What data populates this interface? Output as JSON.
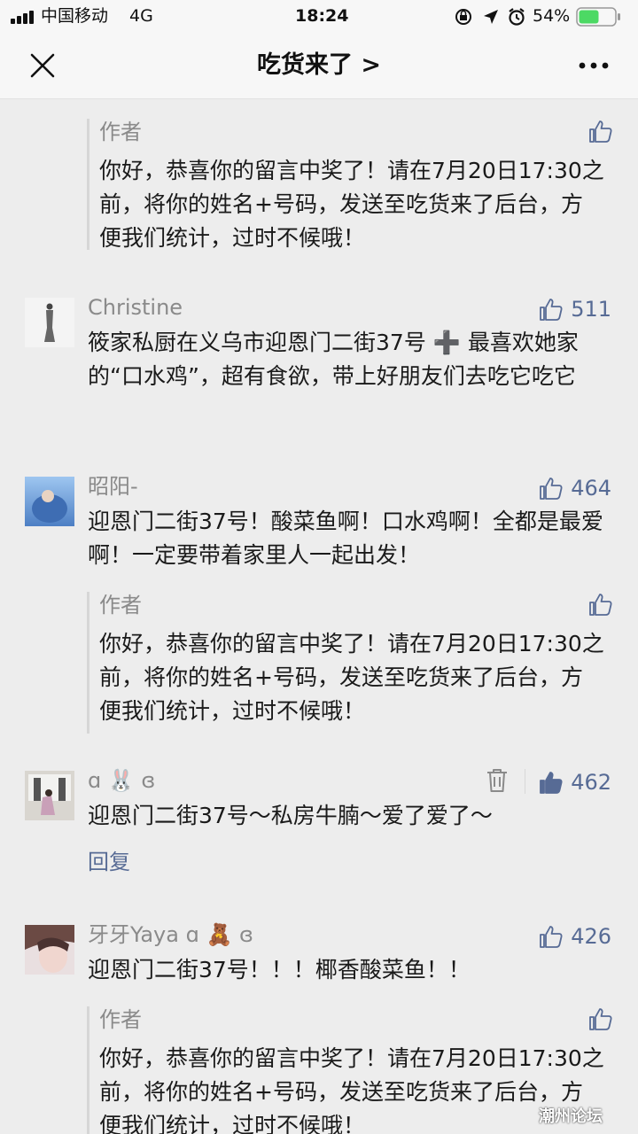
{
  "status_bar": {
    "carrier": "中国移动",
    "network": "4G",
    "time": "18:24",
    "battery": "54%",
    "icons": [
      "signal-icon",
      "rotation-lock-icon",
      "location-icon",
      "alarm-icon",
      "battery-icon"
    ]
  },
  "nav": {
    "title": "吃货来了 >",
    "icons": [
      "close-icon",
      "more-icon"
    ]
  },
  "colors": {
    "link": "#576b95",
    "meta": "#8a8a8a",
    "background": "#ededed"
  },
  "comments": [
    {
      "reply": {
        "author": "作者",
        "text": "你好，恭喜你的留言中奖了！请在7月20日17:30之前，将你的姓名+号码，发送至吃货来了后台，方便我们统计，过时不候哦！"
      }
    },
    {
      "name": "Christine",
      "likes": "511",
      "text": "筱家私厨在义乌市迎恩门二街37号 ➕ 最喜欢她家的“口水鸡”，超有食欲，带上好朋友们去吃它吃它"
    },
    {
      "name": "昭阳-",
      "likes": "464",
      "text": "迎恩门二街37号！酸菜鱼啊！口水鸡啊！全都是最爱啊！一定要带着家里人一起出发！",
      "reply": {
        "author": "作者",
        "text": "你好，恭喜你的留言中奖了！请在7月20日17:30之前，将你的姓名+号码，发送至吃货来了后台，方便我们统计，过时不候哦！"
      }
    },
    {
      "name": "ɑ 🐰 ɞ",
      "likes": "462",
      "text": "迎恩门二街37号～私房牛腩～爱了爱了～",
      "reply_label": "回复"
    },
    {
      "name": "牙牙Yaya ɑ 🧸 ɞ",
      "likes": "426",
      "text": "迎恩门二街37号！！！椰香酸菜鱼！！",
      "reply": {
        "author": "作者",
        "text": "你好，恭喜你的留言中奖了！请在7月20日17:30之前，将你的姓名+号码，发送至吃货来了后台，方便我们统计，过时不候哦！"
      }
    }
  ],
  "watermark": "潮州论坛"
}
